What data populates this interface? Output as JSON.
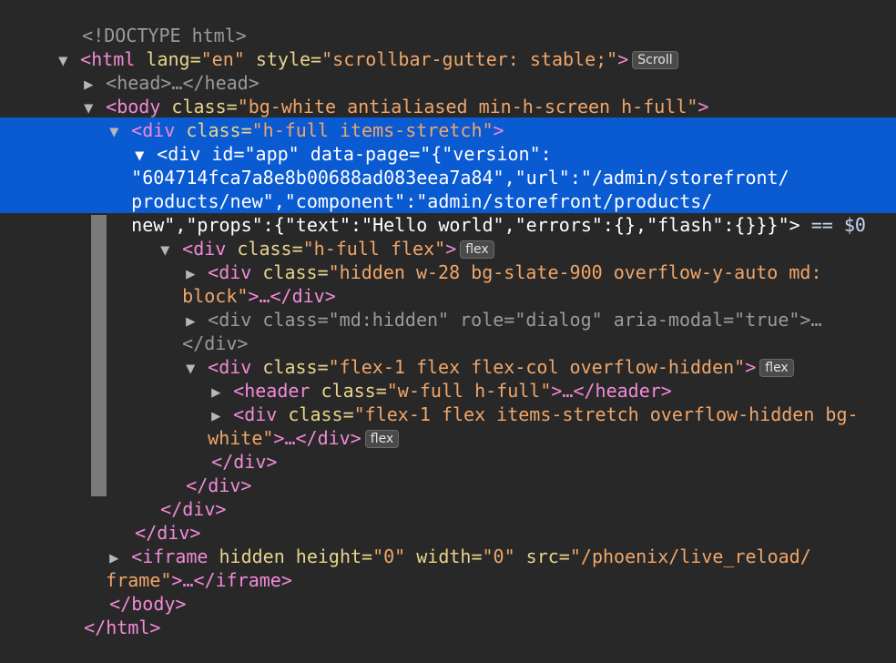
{
  "lines": {
    "doctype": "<!DOCTYPE html>",
    "html_open_tag": "<html",
    "html_lang_attr": " lang=",
    "html_lang_val": "\"en\"",
    "html_style_attr": " style=",
    "html_style_val": "\"scrollbar-gutter: stable;\"",
    "html_close_bracket": ">",
    "html_badge": "Scroll",
    "head_collapsed": "<head>…</head>",
    "body_open_tag": "<body",
    "body_class_attr": " class=",
    "body_class_val": "\"bg-white antialiased min-h-screen h-full\"",
    "body_close_bracket": ">",
    "div1_open_tag": "<div",
    "div1_class_attr": " class=",
    "div1_class_val": "\"h-full items-stretch\"",
    "div1_close_bracket": ">",
    "app_line1_tag": "<div",
    "app_line1_id_attr": " id=",
    "app_line1_id_val": "\"app\"",
    "app_line1_dp_attr": " data-page=",
    "app_line1_dp_val": "\"{\"version\":",
    "app_line2": "\"604714fca7a8e8b00688ad083eea7a84\",\"url\":\"/admin/storefront/",
    "app_line3": "products/new\",\"component\":\"admin/storefront/products/",
    "app_line4": "new\",\"props\":{\"text\":\"Hello world\",\"errors\":{},\"flash\":{}}}\">",
    "app_line4_eq": " == $0",
    "flexdiv_tag": "<div",
    "flexdiv_class_attr": " class=",
    "flexdiv_class_val": "\"h-full flex\"",
    "flexdiv_close": ">",
    "flexdiv_badge": "flex",
    "sidebar_tag": "<div",
    "sidebar_class_attr": " class=",
    "sidebar_class_val_1": "\"hidden w-28 bg-slate-900 overflow-y-auto md:",
    "sidebar_class_val_2": "block\"",
    "sidebar_close": ">…</div>",
    "dialog_tag": "<div",
    "dialog_class_attr": " class=",
    "dialog_class_val": "\"md:hidden\"",
    "dialog_role_attr": " role=",
    "dialog_role_val": "\"dialog\"",
    "dialog_aria_attr": " aria-modal=",
    "dialog_aria_val": "\"true\"",
    "dialog_close_1": ">…",
    "dialog_close_2": "</div>",
    "col_tag": "<div",
    "col_class_attr": " class=",
    "col_class_val": "\"flex-1 flex flex-col overflow-hidden\"",
    "col_close": ">",
    "col_badge": "flex",
    "header_tag": "<header",
    "header_class_attr": " class=",
    "header_class_val": "\"w-full h-full\"",
    "header_close": ">…</header>",
    "main_tag": "<div",
    "main_class_attr": " class=",
    "main_class_val_1": "\"flex-1 flex items-stretch overflow-hidden bg-",
    "main_class_val_2": "white\"",
    "main_close": ">…</div>",
    "main_badge": "flex",
    "close_div_a": "</div>",
    "close_div_b": "</div>",
    "close_div_c": "</div>",
    "close_div_d": "</div>",
    "iframe_tag": "<iframe",
    "iframe_hidden_attr": " hidden",
    "iframe_height_attr": " height=",
    "iframe_height_val": "\"0\"",
    "iframe_width_attr": " width=",
    "iframe_width_val": "\"0\"",
    "iframe_src_attr": " src=",
    "iframe_src_val_1": "\"/phoenix/live_reload/",
    "iframe_src_val_2": "frame\"",
    "iframe_close": ">…</iframe>",
    "body_close": "</body>",
    "html_close": "</html>"
  },
  "icons": {
    "expanded": "▼",
    "collapsed": "▶"
  },
  "colors": {
    "background": "#282828",
    "selection": "#0a5ad2",
    "tag": "#f28ad7",
    "attribute": "#e8d48a",
    "value": "#f0a66a"
  }
}
